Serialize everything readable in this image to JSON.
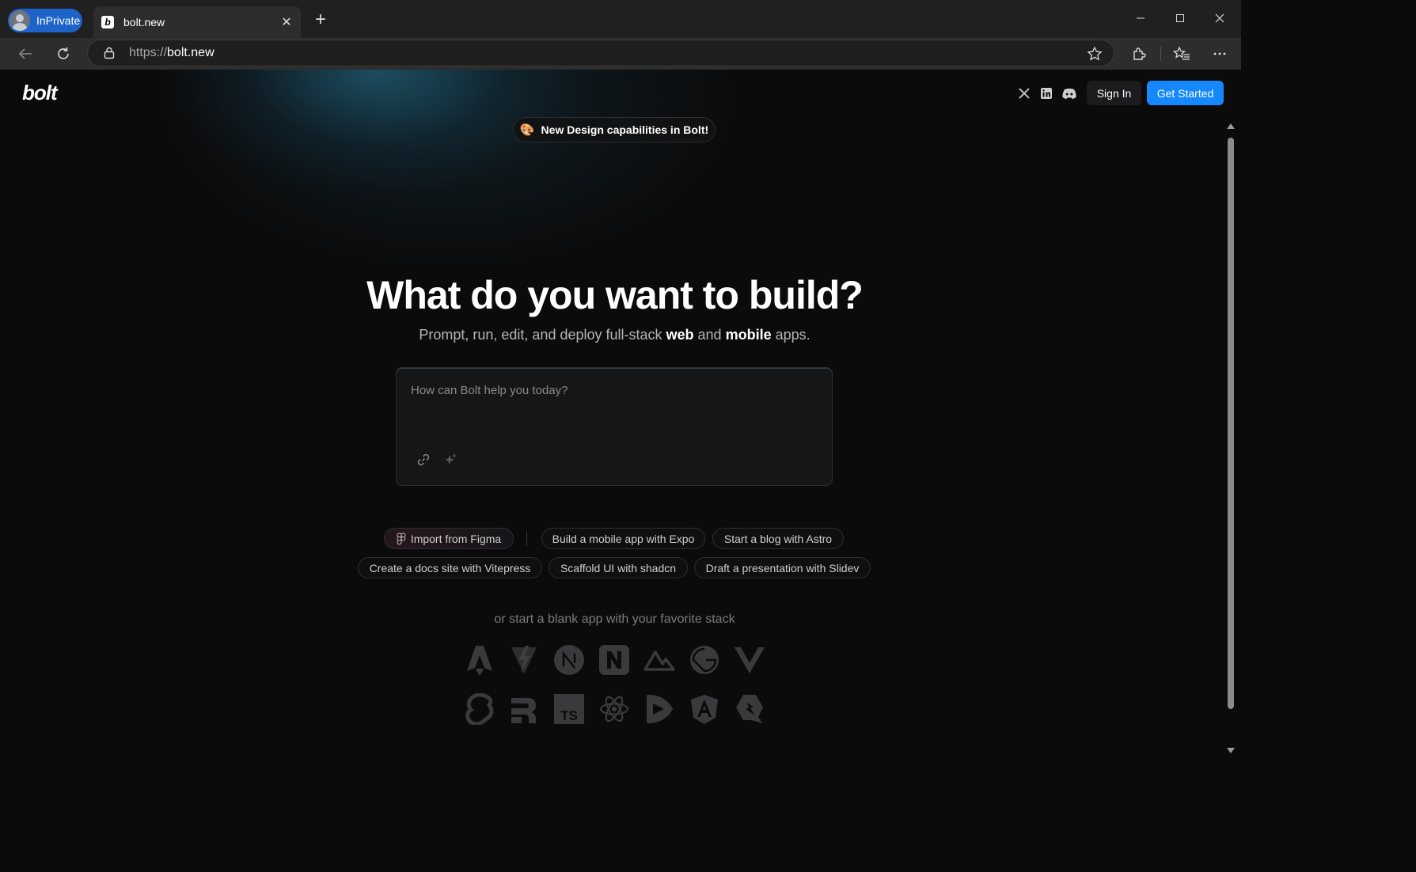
{
  "browser": {
    "inprivate_label": "InPrivate",
    "tab_title": "bolt.new",
    "url_protocol": "https://",
    "url_host": "bolt.new"
  },
  "header": {
    "logo": "bolt",
    "signin_label": "Sign In",
    "get_started_label": "Get Started",
    "accent_color": "#1488fc"
  },
  "announcement": {
    "emoji": "🎨",
    "text": "New Design capabilities in Bolt!"
  },
  "hero": {
    "title": "What do you want to build?",
    "subtitle_pre": "Prompt, run, edit, and deploy full-stack ",
    "subtitle_web": "web",
    "subtitle_mid": " and ",
    "subtitle_mobile": "mobile",
    "subtitle_post": " apps."
  },
  "prompt": {
    "placeholder": "How can Bolt help you today?",
    "value": ""
  },
  "suggestions": [
    "Import from Figma",
    "Build a mobile app with Expo",
    "Start a blog with Astro",
    "Create a docs site with Vitepress",
    "Scaffold UI with shadcn",
    "Draft a presentation with Slidev"
  ],
  "stack": {
    "text": "or start a blank app with your favorite stack",
    "icons": [
      "astro-icon",
      "vite-icon",
      "next-icon",
      "nuxt-icon",
      "nuxt-mountain-icon",
      "gatsby-icon",
      "vue-icon",
      "svelte-icon",
      "remix-icon",
      "typescript-icon",
      "react-icon",
      "slidev-icon",
      "angular-icon",
      "qwik-icon"
    ]
  }
}
